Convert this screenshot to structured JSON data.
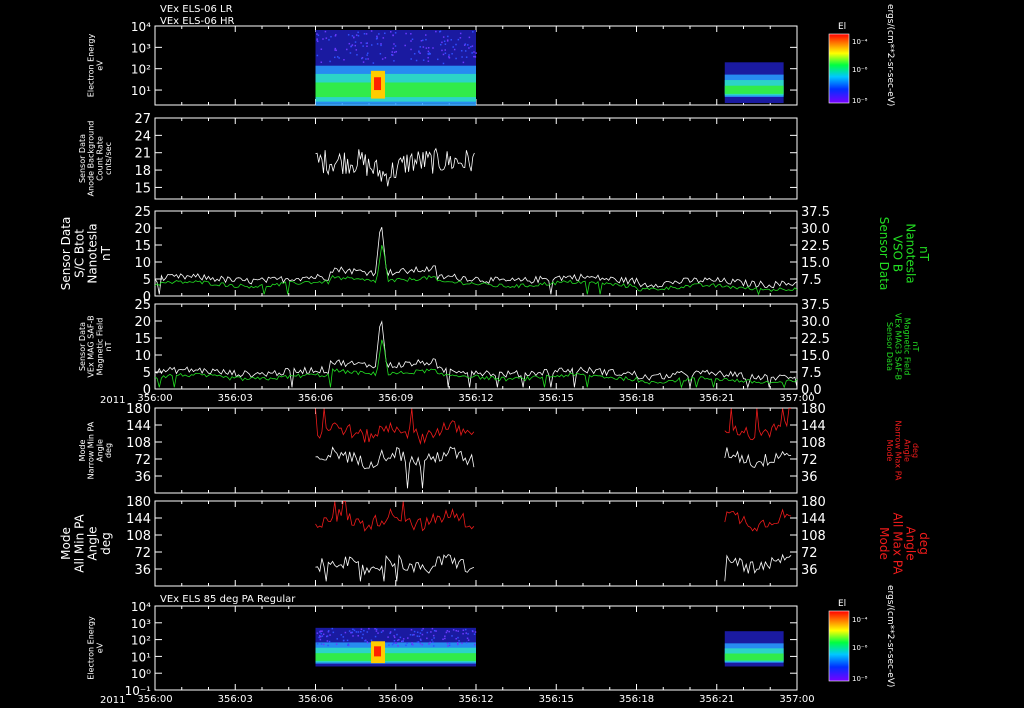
{
  "colors": {
    "background": "#000000",
    "axes": "#ffffff",
    "primary_trace": "#ffffff",
    "green_trace": "#22dd22",
    "red_trace": "#ee1b1b"
  },
  "header": {
    "line1": "VEx ELS-06 LR",
    "line2": "VEx ELS-06 HR",
    "bottom_panel_title": "VEx ELS 85 deg PA Regular"
  },
  "time_axis": {
    "ticks": [
      "356:00",
      "356:03",
      "356:06",
      "356:09",
      "356:12",
      "356:15",
      "356:18",
      "356:21",
      "357:00"
    ],
    "year": "2011"
  },
  "colorbar": {
    "label": "El",
    "ticks": [
      "10⁻⁴",
      "10⁻⁶",
      "10⁻⁸"
    ],
    "units": "ergs/(cm**2-sr-sec-eV)"
  },
  "chart_data": [
    {
      "type": "heatmap",
      "name": "VEx ELS-06 LR / HR",
      "ylabel": [
        "Electron Energy",
        "eV"
      ],
      "yticks": [
        "10⁴",
        "10³",
        "10²",
        "10¹"
      ],
      "yscale": "log",
      "ylim_log10": [
        0.3,
        4.0
      ],
      "segments": [
        {
          "t_start": 6.0,
          "t_end": 12.0
        },
        {
          "t_start": 21.3,
          "t_end": 23.5
        }
      ],
      "hotspot_time": 8.3
    },
    {
      "type": "line",
      "name": "Sensor Data Anode Background Count Rate",
      "ylabel": [
        "Sensor Data",
        "Anode Background",
        "Count Rate",
        "cnts/sec"
      ],
      "ylim": [
        13,
        27
      ],
      "yticks": [
        15,
        18,
        21,
        24,
        27
      ],
      "series": [
        {
          "color": "white",
          "t_range": [
            6.0,
            12.0
          ],
          "mean": 19.5,
          "amplitude": 2.2,
          "dip_at": 8.6
        }
      ]
    },
    {
      "type": "line",
      "name": "Sensor Data S/C Btot",
      "ylabel": [
        "Sensor Data",
        "S/C Btot",
        "Nanotesla",
        "nT"
      ],
      "ylabel_right": [
        "Sensor Data",
        "VSO B",
        "Nanotesla",
        "nT"
      ],
      "ylim": [
        0,
        25
      ],
      "yticks": [
        0,
        5,
        10,
        15,
        20,
        25
      ],
      "yticks_right": [
        7.5,
        15.0,
        22.5,
        30.0,
        37.5
      ],
      "series": [
        {
          "color": "white",
          "t_range": [
            0,
            24
          ],
          "peak_time": 8.45,
          "peak_value": 22.5
        },
        {
          "color": "green",
          "t_range": [
            0,
            24
          ],
          "peak_time": 8.5,
          "peak_value": 16.0
        }
      ]
    },
    {
      "type": "line",
      "name": "Sensor Data VEx MAG SAF-B Magnetic Field",
      "ylabel": [
        "Sensor Data",
        "VEx MAG SAF-B",
        "Magnetic Field",
        "nT"
      ],
      "ylabel_right": [
        "Sensor Data",
        "VEx MAG3 SAF-B",
        "Magnetic Field",
        "nT"
      ],
      "ylim": [
        0,
        25
      ],
      "yticks": [
        0,
        5,
        10,
        15,
        20,
        25
      ],
      "yticks_right": [
        0.0,
        7.5,
        15.0,
        22.5,
        30.0,
        37.5
      ],
      "series": [
        {
          "color": "white",
          "t_range": [
            0,
            24
          ],
          "peak_time": 8.45,
          "peak_value": 22.0
        },
        {
          "color": "green",
          "t_range": [
            0,
            24
          ],
          "peak_time": 8.5,
          "peak_value": 15.5
        }
      ]
    },
    {
      "type": "line",
      "name": "Mode Narrow Min/Max PA",
      "ylabel": [
        "Mode",
        "Narrow Min PA",
        "Angle",
        "deg"
      ],
      "ylabel_right": [
        "Mode",
        "Narrow Max PA",
        "Angle",
        "deg"
      ],
      "ylim": [
        0,
        180
      ],
      "yticks": [
        36,
        72,
        108,
        144,
        180
      ],
      "series": [
        {
          "color": "white",
          "segments": [
            [
              6.0,
              12.0
            ],
            [
              21.3,
              23.8
            ]
          ],
          "mean": 75
        },
        {
          "color": "red",
          "segments": [
            [
              6.0,
              12.0
            ],
            [
              21.3,
              23.8
            ]
          ],
          "mean": 130
        }
      ]
    },
    {
      "type": "line",
      "name": "Mode All Min/Max PA",
      "ylabel": [
        "Mode",
        "All Min PA",
        "Angle",
        "deg"
      ],
      "ylabel_right": [
        "Mode",
        "All Max PA",
        "Angle",
        "deg"
      ],
      "ylim": [
        0,
        180
      ],
      "yticks": [
        36,
        72,
        108,
        144,
        180
      ],
      "series": [
        {
          "color": "white",
          "segments": [
            [
              6.0,
              12.0
            ],
            [
              21.3,
              23.8
            ]
          ],
          "mean": 45
        },
        {
          "color": "red",
          "segments": [
            [
              6.0,
              12.0
            ],
            [
              21.3,
              23.8
            ]
          ],
          "mean": 140
        }
      ]
    },
    {
      "type": "heatmap",
      "name": "VEx ELS 85 deg PA Regular",
      "ylabel": [
        "Electron Energy",
        "eV"
      ],
      "yticks": [
        "10⁴",
        "10³",
        "10²",
        "10¹",
        "10⁰",
        "10⁻¹"
      ],
      "yscale": "log",
      "ylim_log10": [
        -1.0,
        4.0
      ],
      "segments": [
        {
          "t_start": 6.0,
          "t_end": 12.0
        },
        {
          "t_start": 21.3,
          "t_end": 23.5
        }
      ],
      "hotspot_time": 8.3
    }
  ]
}
